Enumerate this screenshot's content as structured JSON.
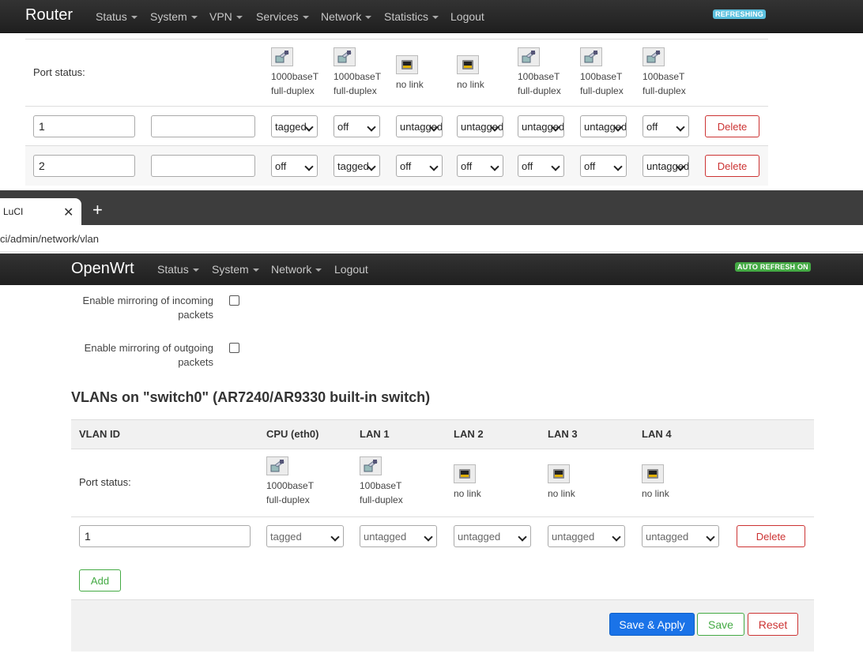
{
  "top": {
    "brand": "Router",
    "menu": [
      "Status",
      "System",
      "VPN",
      "Services",
      "Network",
      "Statistics",
      "Logout"
    ],
    "badge": "REFRESHING",
    "badge_color": "#5bc0de"
  },
  "top_table": {
    "port_status_label": "Port status:",
    "ports": [
      {
        "state": "link",
        "speed": "1000baseT",
        "duplex": "full-duplex"
      },
      {
        "state": "link",
        "speed": "1000baseT",
        "duplex": "full-duplex"
      },
      {
        "state": "nolink",
        "speed": "no link",
        "duplex": ""
      },
      {
        "state": "nolink",
        "speed": "no link",
        "duplex": ""
      },
      {
        "state": "link",
        "speed": "100baseT",
        "duplex": "full-duplex"
      },
      {
        "state": "link",
        "speed": "100baseT",
        "duplex": "full-duplex"
      },
      {
        "state": "link",
        "speed": "100baseT",
        "duplex": "full-duplex"
      }
    ],
    "rows": [
      {
        "vlan_id": "1",
        "description": "",
        "values": [
          "tagged",
          "off",
          "untagged",
          "untagged",
          "untagged",
          "untagged",
          "off"
        ],
        "delete": "Delete"
      },
      {
        "vlan_id": "2",
        "description": "",
        "values": [
          "off",
          "tagged",
          "off",
          "off",
          "off",
          "off",
          "untagged"
        ],
        "delete": "Delete"
      }
    ]
  },
  "browser": {
    "tab_title": "LuCI",
    "tab_close": "✕",
    "new_tab": "+",
    "url": "ci/admin/network/vlan"
  },
  "openwrt": {
    "brand": "OpenWrt",
    "menu": [
      "Status",
      "System",
      "Network",
      "Logout"
    ],
    "badge": "AUTO REFRESH ON",
    "badge_color": "#4a4",
    "mirroring_incoming": [
      "Enable mirroring of incoming",
      "packets"
    ],
    "mirroring_outgoing": [
      "Enable mirroring of outgoing",
      "packets"
    ],
    "section_title": "VLANs on \"switch0\" (AR7240/AR9330 built-in switch)",
    "headers": [
      "VLAN ID",
      "CPU (eth0)",
      "LAN 1",
      "LAN 2",
      "LAN 3",
      "LAN 4"
    ],
    "port_status_label": "Port status:",
    "ports": [
      {
        "state": "link",
        "speed": "1000baseT",
        "duplex": "full-duplex"
      },
      {
        "state": "link",
        "speed": "100baseT",
        "duplex": "full-duplex"
      },
      {
        "state": "nolink",
        "speed": "no link",
        "duplex": ""
      },
      {
        "state": "nolink",
        "speed": "no link",
        "duplex": ""
      },
      {
        "state": "nolink",
        "speed": "no link",
        "duplex": ""
      }
    ],
    "row": {
      "vlan_id": "1",
      "values": [
        "tagged",
        "untagged",
        "untagged",
        "untagged",
        "untagged"
      ],
      "delete": "Delete"
    },
    "add": "Add",
    "save_apply": "Save & Apply",
    "save": "Save",
    "reset": "Reset"
  }
}
